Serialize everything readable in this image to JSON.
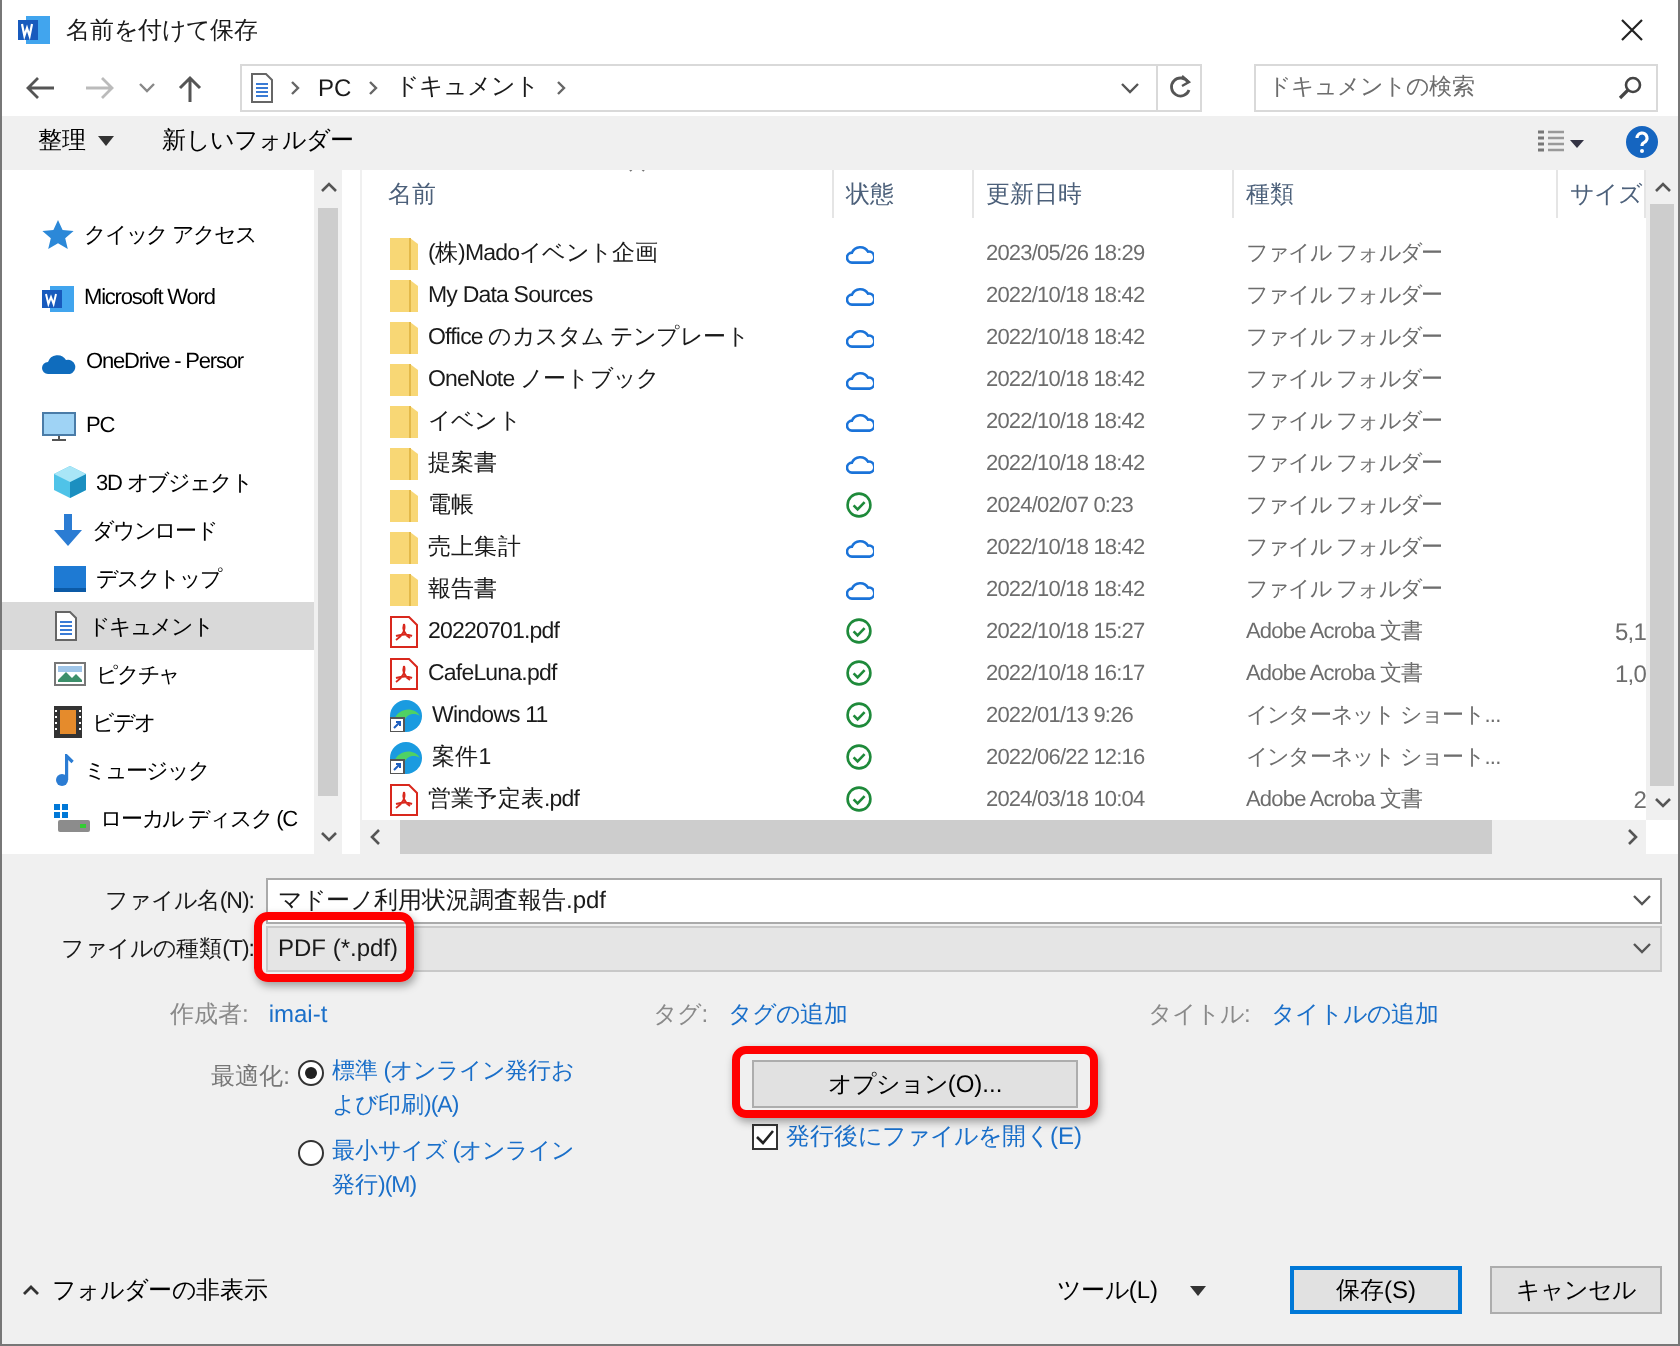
{
  "window": {
    "title": "名前を付けて保存"
  },
  "address": {
    "crumbs": [
      "PC",
      "ドキュメント"
    ]
  },
  "search": {
    "placeholder": "ドキュメントの検索"
  },
  "toolbar": {
    "organize": "整理",
    "new_folder": "新しいフォルダー"
  },
  "sidebar": {
    "items": [
      {
        "label": "クイック アクセス",
        "selected": false
      },
      {
        "label": "Microsoft Word",
        "selected": false
      },
      {
        "label": "OneDrive - Persor",
        "selected": false
      },
      {
        "label": "PC",
        "selected": false,
        "children": [
          {
            "label": "3D オブジェクト",
            "selected": false
          },
          {
            "label": "ダウンロード",
            "selected": false
          },
          {
            "label": "デスクトップ",
            "selected": false
          },
          {
            "label": "ドキュメント",
            "selected": true
          },
          {
            "label": "ピクチャ",
            "selected": false
          },
          {
            "label": "ビデオ",
            "selected": false
          },
          {
            "label": "ミュージック",
            "selected": false
          },
          {
            "label": "ローカル ディスク (C",
            "selected": false
          }
        ]
      }
    ]
  },
  "table": {
    "columns": [
      "名前",
      "状態",
      "更新日時",
      "種類",
      "サイズ"
    ],
    "rows": [
      {
        "kind": "folder",
        "name": "(株)Madoイベント企画",
        "synced": false,
        "date": "2023/05/26 18:29",
        "type": "ファイル フォルダー"
      },
      {
        "kind": "folder",
        "name": "My Data Sources",
        "synced": false,
        "date": "2022/10/18 18:42",
        "type": "ファイル フォルダー"
      },
      {
        "kind": "folder",
        "name": "Office のカスタム テンプレート",
        "synced": false,
        "date": "2022/10/18 18:42",
        "type": "ファイル フォルダー"
      },
      {
        "kind": "folder",
        "name": "OneNote ノートブック",
        "synced": false,
        "date": "2022/10/18 18:42",
        "type": "ファイル フォルダー"
      },
      {
        "kind": "folder",
        "name": "イベント",
        "synced": false,
        "date": "2022/10/18 18:42",
        "type": "ファイル フォルダー"
      },
      {
        "kind": "folder",
        "name": "提案書",
        "synced": false,
        "date": "2022/10/18 18:42",
        "type": "ファイル フォルダー"
      },
      {
        "kind": "folder",
        "name": "電帳",
        "synced": true,
        "date": "2024/02/07 0:23",
        "type": "ファイル フォルダー"
      },
      {
        "kind": "folder",
        "name": "売上集計",
        "synced": false,
        "date": "2022/10/18 18:42",
        "type": "ファイル フォルダー"
      },
      {
        "kind": "folder",
        "name": "報告書",
        "synced": false,
        "date": "2022/10/18 18:42",
        "type": "ファイル フォルダー"
      },
      {
        "kind": "pdf",
        "name": "20220701.pdf",
        "synced": true,
        "date": "2022/10/18 15:27",
        "type": "Adobe Acroba 文書",
        "size": "5,1"
      },
      {
        "kind": "pdf",
        "name": "CafeLuna.pdf",
        "synced": true,
        "date": "2022/10/18 16:17",
        "type": "Adobe Acroba 文書",
        "size": "1,0"
      },
      {
        "kind": "shortcut",
        "name": "Windows 11",
        "synced": true,
        "date": "2022/01/13 9:26",
        "type": "インターネット ショート..."
      },
      {
        "kind": "shortcut",
        "name": "案件1",
        "synced": true,
        "date": "2022/06/22 12:16",
        "type": "インターネット ショート..."
      },
      {
        "kind": "pdf",
        "name": "営業予定表.pdf",
        "synced": true,
        "date": "2024/03/18 10:04",
        "type": "Adobe Acroba 文書",
        "size": "2"
      }
    ]
  },
  "form": {
    "file_name": {
      "label": "ファイル名(N):",
      "value": "マドーノ利用状況調査報告.pdf"
    },
    "file_type": {
      "label": "ファイルの種類(T):",
      "value": "PDF (*.pdf)",
      "highlighted": true
    },
    "metadata": [
      {
        "label": "作成者:",
        "value": "imai-t"
      },
      {
        "label": "タグ:",
        "value": "タグの追加"
      },
      {
        "label": "タイトル:",
        "value": "タイトルの追加"
      }
    ],
    "optimize": {
      "label": "最適化:",
      "options": [
        {
          "label": "標準 (オンライン発行および印刷)(A)",
          "selected": true
        },
        {
          "label": "最小サイズ (オンライン発行)(M)",
          "selected": false
        }
      ]
    },
    "options_button": {
      "label": "オプション(O)...",
      "highlighted": true
    },
    "open_after": {
      "label": "発行後にファイルを開く(E)",
      "checked": true
    }
  },
  "footer": {
    "hide_folders": "フォルダーの非表示",
    "tools": "ツール(L)",
    "buttons": [
      {
        "label": "保存(S)",
        "default": true
      },
      {
        "label": "キャンセル",
        "default": false
      }
    ]
  }
}
